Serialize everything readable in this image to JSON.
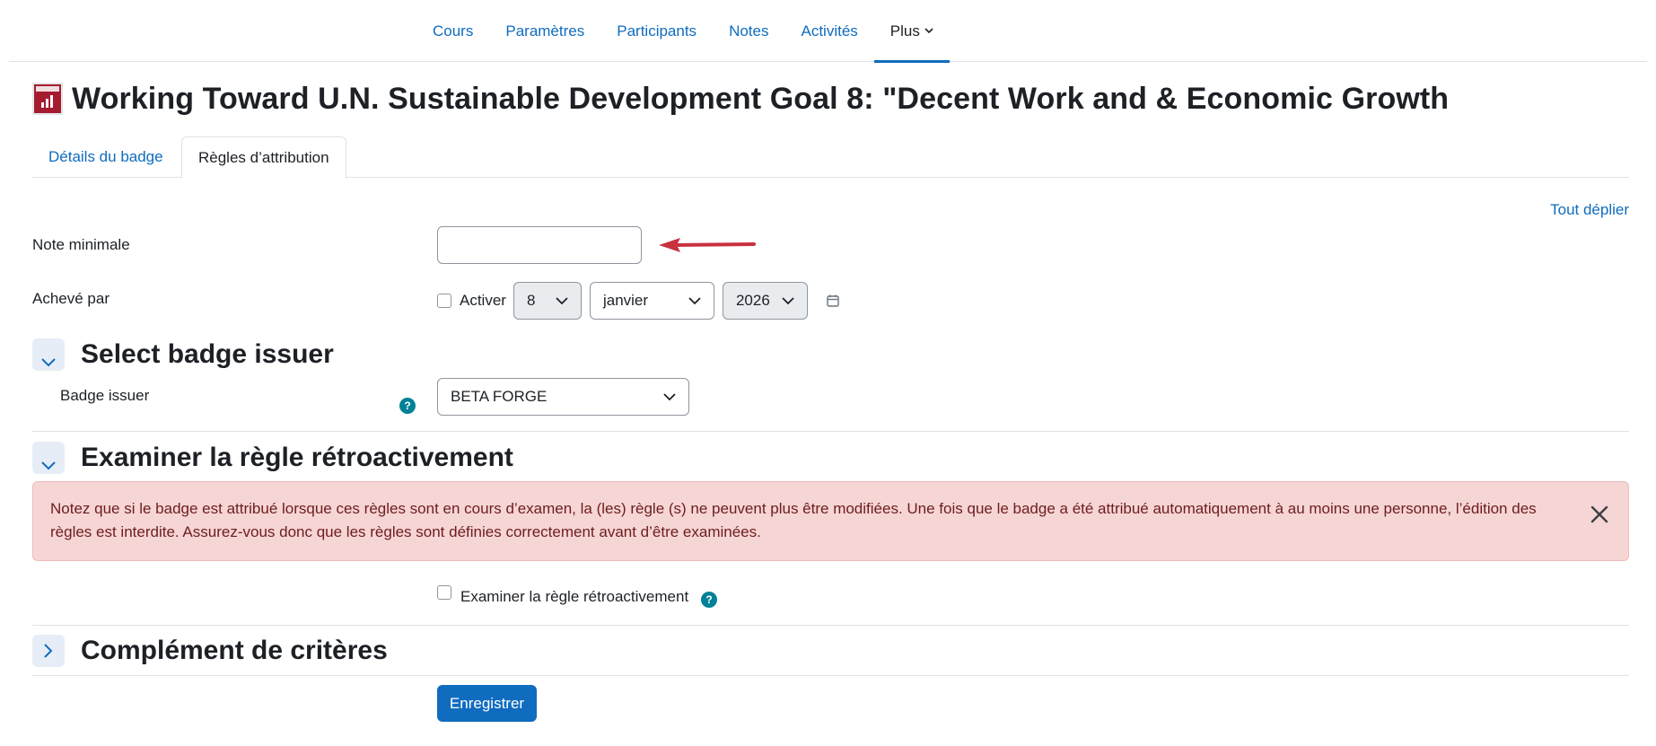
{
  "nav": {
    "items": [
      {
        "label": "Cours"
      },
      {
        "label": "Paramètres"
      },
      {
        "label": "Participants"
      },
      {
        "label": "Notes"
      },
      {
        "label": "Activités"
      },
      {
        "label": "Plus"
      }
    ],
    "active": "Plus"
  },
  "page": {
    "title": "Working Toward U.N. Sustainable Development Goal 8: \"Decent Work and & Economic Growth"
  },
  "tabs": [
    {
      "label": "Détails du badge"
    },
    {
      "label": "Règles d’attribution"
    }
  ],
  "expand_all": "Tout déplier",
  "form": {
    "min_grade_label": "Note minimale",
    "min_grade_value": "",
    "completed_by_label": "Achevé par",
    "enable_label": "Activer",
    "day": "8",
    "month": "janvier",
    "year": "2026"
  },
  "sections": {
    "issuer": {
      "title": "Select badge issuer",
      "field_label": "Badge issuer",
      "selected": "BETA FORGE"
    },
    "retro": {
      "title": "Examiner la règle rétroactivement",
      "alert": "Notez que si le badge est attribué lorsque ces règles sont en cours d’examen, la (les) règle (s) ne peuvent plus être modifiées. Une fois que le badge a été attribué automatiquement à au moins une personne, l’édition des règles est interdite. Assurez-vous donc que les règles sont définies correctement avant d’être examinées.",
      "checkbox_label": "Examiner la règle rétroactivement"
    },
    "extra": {
      "title": "Complément de critères"
    }
  },
  "save_label": "Enregistrer",
  "colors": {
    "link": "#0f6cbf",
    "primary_button": "#0f6cbf",
    "alert_bg": "#f6d5d5",
    "help_icon": "#008196",
    "annotation_arrow": "#c8313e"
  }
}
